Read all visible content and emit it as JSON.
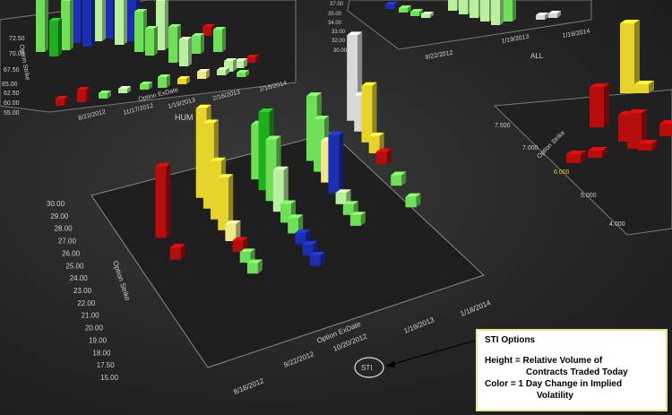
{
  "colors": {
    "up_strong": "#1fae1f",
    "up": "#6fdf5a",
    "up_light": "#b9f0a0",
    "flat": "#d8d8d8",
    "down_light": "#f1e88a",
    "down": "#e6d32c",
    "down_strong": "#b60d0d",
    "volatile_blue": "#1c2fb0"
  },
  "main_chart": {
    "label": "STI",
    "y_axis": {
      "title": "Option Strike",
      "ticks": [
        "30.00",
        "29.00",
        "28.00",
        "27.00",
        "26.00",
        "25.00",
        "24.00",
        "23.00",
        "22.00",
        "21.00",
        "20.00",
        "19.00",
        "18.00",
        "17.50",
        "15.00"
      ]
    },
    "x_axis": {
      "title": "Option ExDate",
      "ticks": [
        "8/18/2012",
        "9/22/2012",
        "10/20/2012",
        "1/19/2013",
        "1/18/2014"
      ]
    }
  },
  "chart_data": [
    {
      "type": "bar",
      "title": "STI",
      "xlabel": "Option ExDate",
      "ylabel": "Option Strike",
      "categories": [
        "8/18/2012",
        "9/22/2012",
        "10/20/2012",
        "1/19/2013",
        "1/18/2014"
      ],
      "strikes": [
        "15.00",
        "17.50",
        "18.00",
        "19.00",
        "20.00",
        "21.00",
        "22.00",
        "23.00",
        "24.00",
        "25.00",
        "26.00",
        "27.00",
        "28.00",
        "29.00",
        "30.00"
      ],
      "height_meaning": "Relative Volume of Contracts Traded Today",
      "color_meaning": "1 Day Change in Implied Volatility",
      "bars": [
        {
          "exdate": "8/18/2012",
          "strike": "26.00",
          "height": 0.78,
          "color": "down_strong"
        },
        {
          "exdate": "8/18/2012",
          "strike": "24.00",
          "height": 0.06,
          "color": "down_strong"
        },
        {
          "exdate": "9/22/2012",
          "strike": "28.00",
          "height": 1.0,
          "color": "down"
        },
        {
          "exdate": "9/22/2012",
          "strike": "27.00",
          "height": 0.95,
          "color": "down"
        },
        {
          "exdate": "9/22/2012",
          "strike": "26.00",
          "height": 0.62,
          "color": "down"
        },
        {
          "exdate": "9/22/2012",
          "strike": "25.00",
          "height": 0.55,
          "color": "down"
        },
        {
          "exdate": "9/22/2012",
          "strike": "24.00",
          "height": 0.12,
          "color": "down_light"
        },
        {
          "exdate": "9/22/2012",
          "strike": "23.00",
          "height": 0.05,
          "color": "down_strong"
        },
        {
          "exdate": "9/22/2012",
          "strike": "22.00",
          "height": 0.04,
          "color": "up"
        },
        {
          "exdate": "9/22/2012",
          "strike": "21.00",
          "height": 0.04,
          "color": "up"
        },
        {
          "exdate": "10/20/2012",
          "strike": "28.00",
          "height": 0.58,
          "color": "up"
        },
        {
          "exdate": "10/20/2012",
          "strike": "27.00",
          "height": 0.86,
          "color": "up_strong"
        },
        {
          "exdate": "10/20/2012",
          "strike": "26.00",
          "height": 0.66,
          "color": "up"
        },
        {
          "exdate": "10/20/2012",
          "strike": "25.00",
          "height": 0.42,
          "color": "up_light"
        },
        {
          "exdate": "10/20/2012",
          "strike": "24.00",
          "height": 0.14,
          "color": "up"
        },
        {
          "exdate": "10/20/2012",
          "strike": "23.00",
          "height": 0.1,
          "color": "up"
        },
        {
          "exdate": "10/20/2012",
          "strike": "22.00",
          "height": 0.05,
          "color": "volatile_blue"
        },
        {
          "exdate": "10/20/2012",
          "strike": "21.00",
          "height": 0.04,
          "color": "volatile_blue"
        },
        {
          "exdate": "10/20/2012",
          "strike": "20.00",
          "height": 0.04,
          "color": "volatile_blue"
        },
        {
          "exdate": "1/19/2013",
          "strike": "28.00",
          "height": 0.7,
          "color": "up"
        },
        {
          "exdate": "1/19/2013",
          "strike": "27.00",
          "height": 0.55,
          "color": "up"
        },
        {
          "exdate": "1/19/2013",
          "strike": "26.00",
          "height": 0.42,
          "color": "down_light"
        },
        {
          "exdate": "1/19/2013",
          "strike": "25.00",
          "height": 0.62,
          "color": "volatile_blue"
        },
        {
          "exdate": "1/19/2013",
          "strike": "24.00",
          "height": 0.05,
          "color": "up_light"
        },
        {
          "exdate": "1/19/2013",
          "strike": "23.00",
          "height": 0.04,
          "color": "up"
        },
        {
          "exdate": "1/19/2013",
          "strike": "22.00",
          "height": 0.04,
          "color": "up"
        },
        {
          "exdate": "1/18/2014",
          "strike": "30.00",
          "height": 0.95,
          "color": "flat"
        },
        {
          "exdate": "1/18/2014",
          "strike": "29.00",
          "height": 0.35,
          "color": "flat"
        },
        {
          "exdate": "1/18/2014",
          "strike": "28.00",
          "height": 0.6,
          "color": "down"
        },
        {
          "exdate": "1/18/2014",
          "strike": "27.00",
          "height": 0.12,
          "color": "down"
        },
        {
          "exdate": "1/18/2014",
          "strike": "26.00",
          "height": 0.06,
          "color": "down_strong"
        },
        {
          "exdate": "1/18/2014",
          "strike": "24.00",
          "height": 0.04,
          "color": "up"
        },
        {
          "exdate": "1/18/2014",
          "strike": "22.00",
          "height": 0.04,
          "color": "up"
        }
      ]
    },
    {
      "type": "bar",
      "title": "HUM",
      "xlabel": "Option ExDate",
      "ylabel": "Option Strike",
      "categories": [
        "8/22/2012",
        "11/17/2012",
        "1/19/2013",
        "2/16/2013",
        "1/18/2014"
      ],
      "y_ticks": [
        "55.00",
        "60.00",
        "62.50",
        "65.00",
        "67.50",
        "70.00",
        "72.50"
      ]
    },
    {
      "type": "bar",
      "title": "ALL",
      "xlabel": "Option ExDate",
      "ylabel": "Option Strike",
      "categories": [
        "8/22/2012",
        "1/19/2013",
        "1/18/2014"
      ],
      "y_ticks": [
        "37.00",
        "35.00",
        "34.00",
        "33.00",
        "32.00",
        "30.00"
      ]
    },
    {
      "type": "bar",
      "title": "",
      "xlabel": "",
      "ylabel": "Option Strike",
      "y_ticks": [
        "7.500",
        "7.000",
        "6.000",
        "5.000",
        "4.000"
      ]
    }
  ],
  "hum_chart": {
    "label": "HUM",
    "x_title": "Option ExDate",
    "y_title": "Option Strike",
    "y_ticks": [
      "72.50",
      "70.00",
      "67.50",
      "65.00",
      "62.50",
      "60.00",
      "55.00"
    ],
    "x_ticks": [
      "8/22/2012",
      "11/17/2012",
      "1/19/2013",
      "2/16/2013",
      "1/18/2014"
    ]
  },
  "all_chart": {
    "label": "ALL",
    "y_ticks": [
      "37.00",
      "35.00",
      "34.00",
      "33.00",
      "32.00",
      "30.00"
    ],
    "x_ticks": [
      "8/22/2012",
      "1/19/2013",
      "1/18/2014"
    ]
  },
  "right_chart": {
    "y_title": "Option Strike",
    "y_ticks": [
      "7.500",
      "7.000",
      "6.000",
      "5.000",
      "4.000"
    ]
  },
  "legend_box": {
    "title": "STI Options",
    "height_line1": "Height = Relative Volume of",
    "height_line2": "Contracts Traded Today",
    "color_line1": "Color = 1 Day Change in Implied",
    "color_line2": "Volatility"
  }
}
